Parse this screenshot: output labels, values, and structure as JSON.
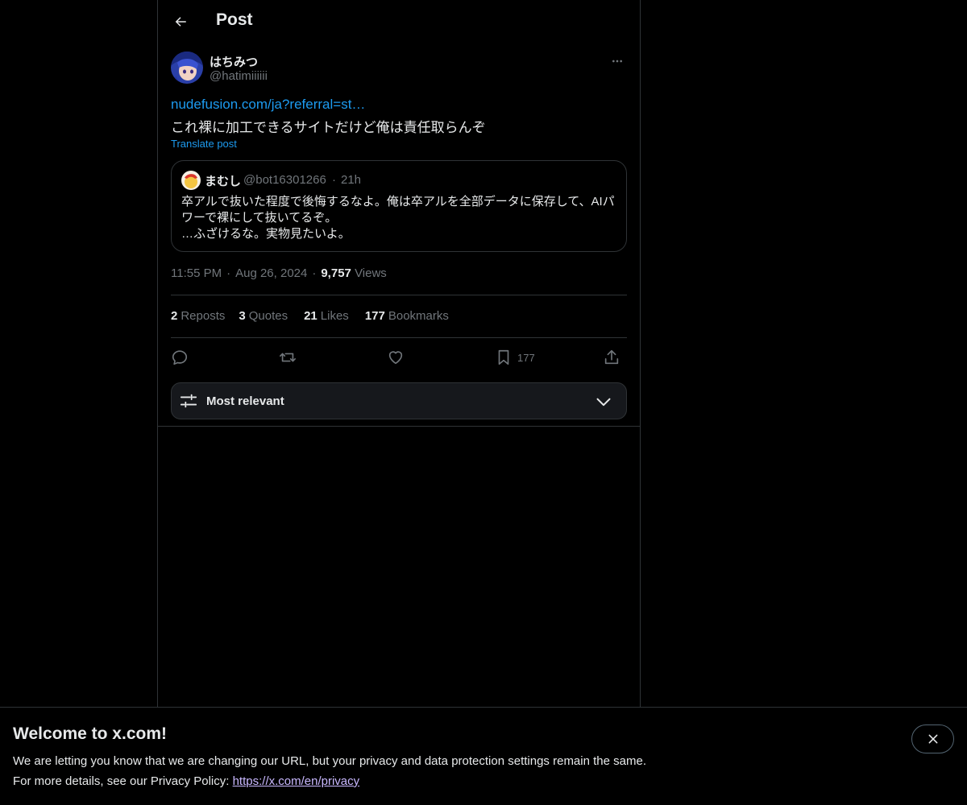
{
  "header": {
    "title": "Post",
    "back_icon": "arrow-left-icon"
  },
  "post": {
    "author_name": "はちみつ",
    "author_handle": "@hatimiiiiii",
    "link_text": "nudefusion.com/ja?referral=st…",
    "text": "これ裸に加工できるサイトだけど俺は責任取らんぞ",
    "translate_label": "Translate post",
    "time": "11:55 PM",
    "date": "Aug 26, 2024",
    "views_count": "9,757",
    "views_label": "Views"
  },
  "quote": {
    "name": "まむし",
    "handle": "@bot16301266",
    "time": "21h",
    "text": "卒アルで抜いた程度で後悔するなよ。俺は卒アルを全部データに保存して、AIパワーで裸にして抜いてるぞ。\n…ふざけるな。実物見たいよ。"
  },
  "stats": [
    {
      "count": "2",
      "label": "Reposts"
    },
    {
      "count": "3",
      "label": "Quotes"
    },
    {
      "count": "21",
      "label": "Likes"
    },
    {
      "count": "177",
      "label": "Bookmarks"
    }
  ],
  "actions": {
    "reply_icon": "reply-icon",
    "repost_icon": "repost-icon",
    "like_icon": "heart-icon",
    "bookmark_icon": "bookmark-icon",
    "bookmark_count": "177",
    "share_icon": "share-icon"
  },
  "sort": {
    "label": "Most relevant"
  },
  "banner": {
    "title": "Welcome to x.com!",
    "line1": "We are letting you know that we are changing our URL, but your privacy and data protection settings remain the same.",
    "line2_prefix": "For more details, see our Privacy Policy: ",
    "line2_link": "https://x.com/en/privacy"
  },
  "colors": {
    "accent": "#1d9bf0",
    "background": "#000000",
    "border": "#2f3336",
    "muted": "#71767b"
  }
}
